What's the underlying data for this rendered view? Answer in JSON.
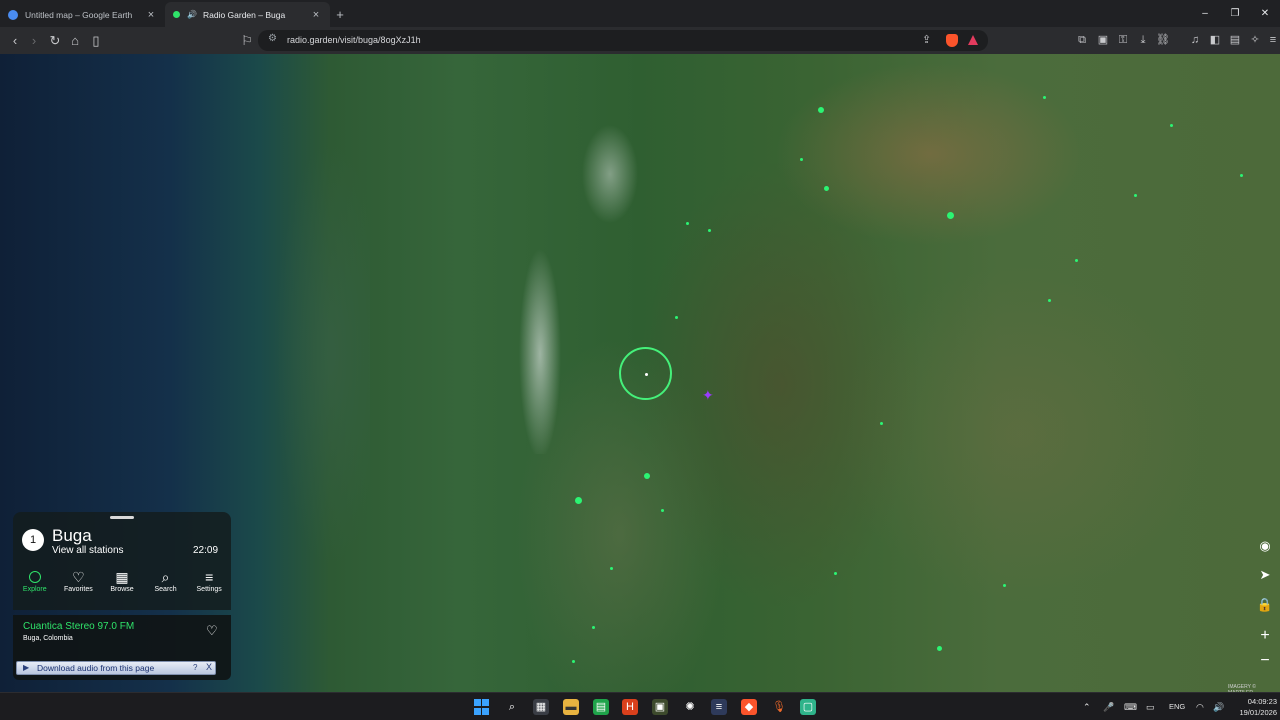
{
  "tabs": [
    {
      "title": "Untitled map – Google Earth",
      "favicon": "google-earth-icon",
      "active": false
    },
    {
      "title": "Radio Garden – Buga",
      "favicon": "radio-garden-icon",
      "active": true,
      "audio": "speaker-icon"
    }
  ],
  "browser": {
    "url": "radio.garden/visit/buga/8ogXzJ1h",
    "new_tab": "+",
    "window_minimize": "–",
    "window_maximize": "❐",
    "window_close": "✕"
  },
  "panel": {
    "count": "1",
    "place": "Buga",
    "view_all": "View all stations",
    "time": "22:09",
    "nav": [
      {
        "label": "Explore",
        "icon": "explore-icon",
        "active": true
      },
      {
        "label": "Favorites",
        "icon": "heart-icon",
        "active": false
      },
      {
        "label": "Browse",
        "icon": "map-icon",
        "active": false
      },
      {
        "label": "Search",
        "icon": "search-icon",
        "active": false
      },
      {
        "label": "Settings",
        "icon": "menu-icon",
        "active": false
      }
    ],
    "station": "Cuantica Stereo 97.0 FM",
    "location": "Buga, Colombia"
  },
  "download_bar": {
    "text": "Download audio from this page",
    "help": "?",
    "close": "X"
  },
  "imagery_credit": "IMAGERY © MAPTILER",
  "taskbar": {
    "language": "ENG",
    "time": "04:09:23",
    "date": "19/01/2026"
  },
  "colors": {
    "accent": "#2fe36a",
    "station_dot": "#2bf573",
    "brave": "#fb542b"
  }
}
